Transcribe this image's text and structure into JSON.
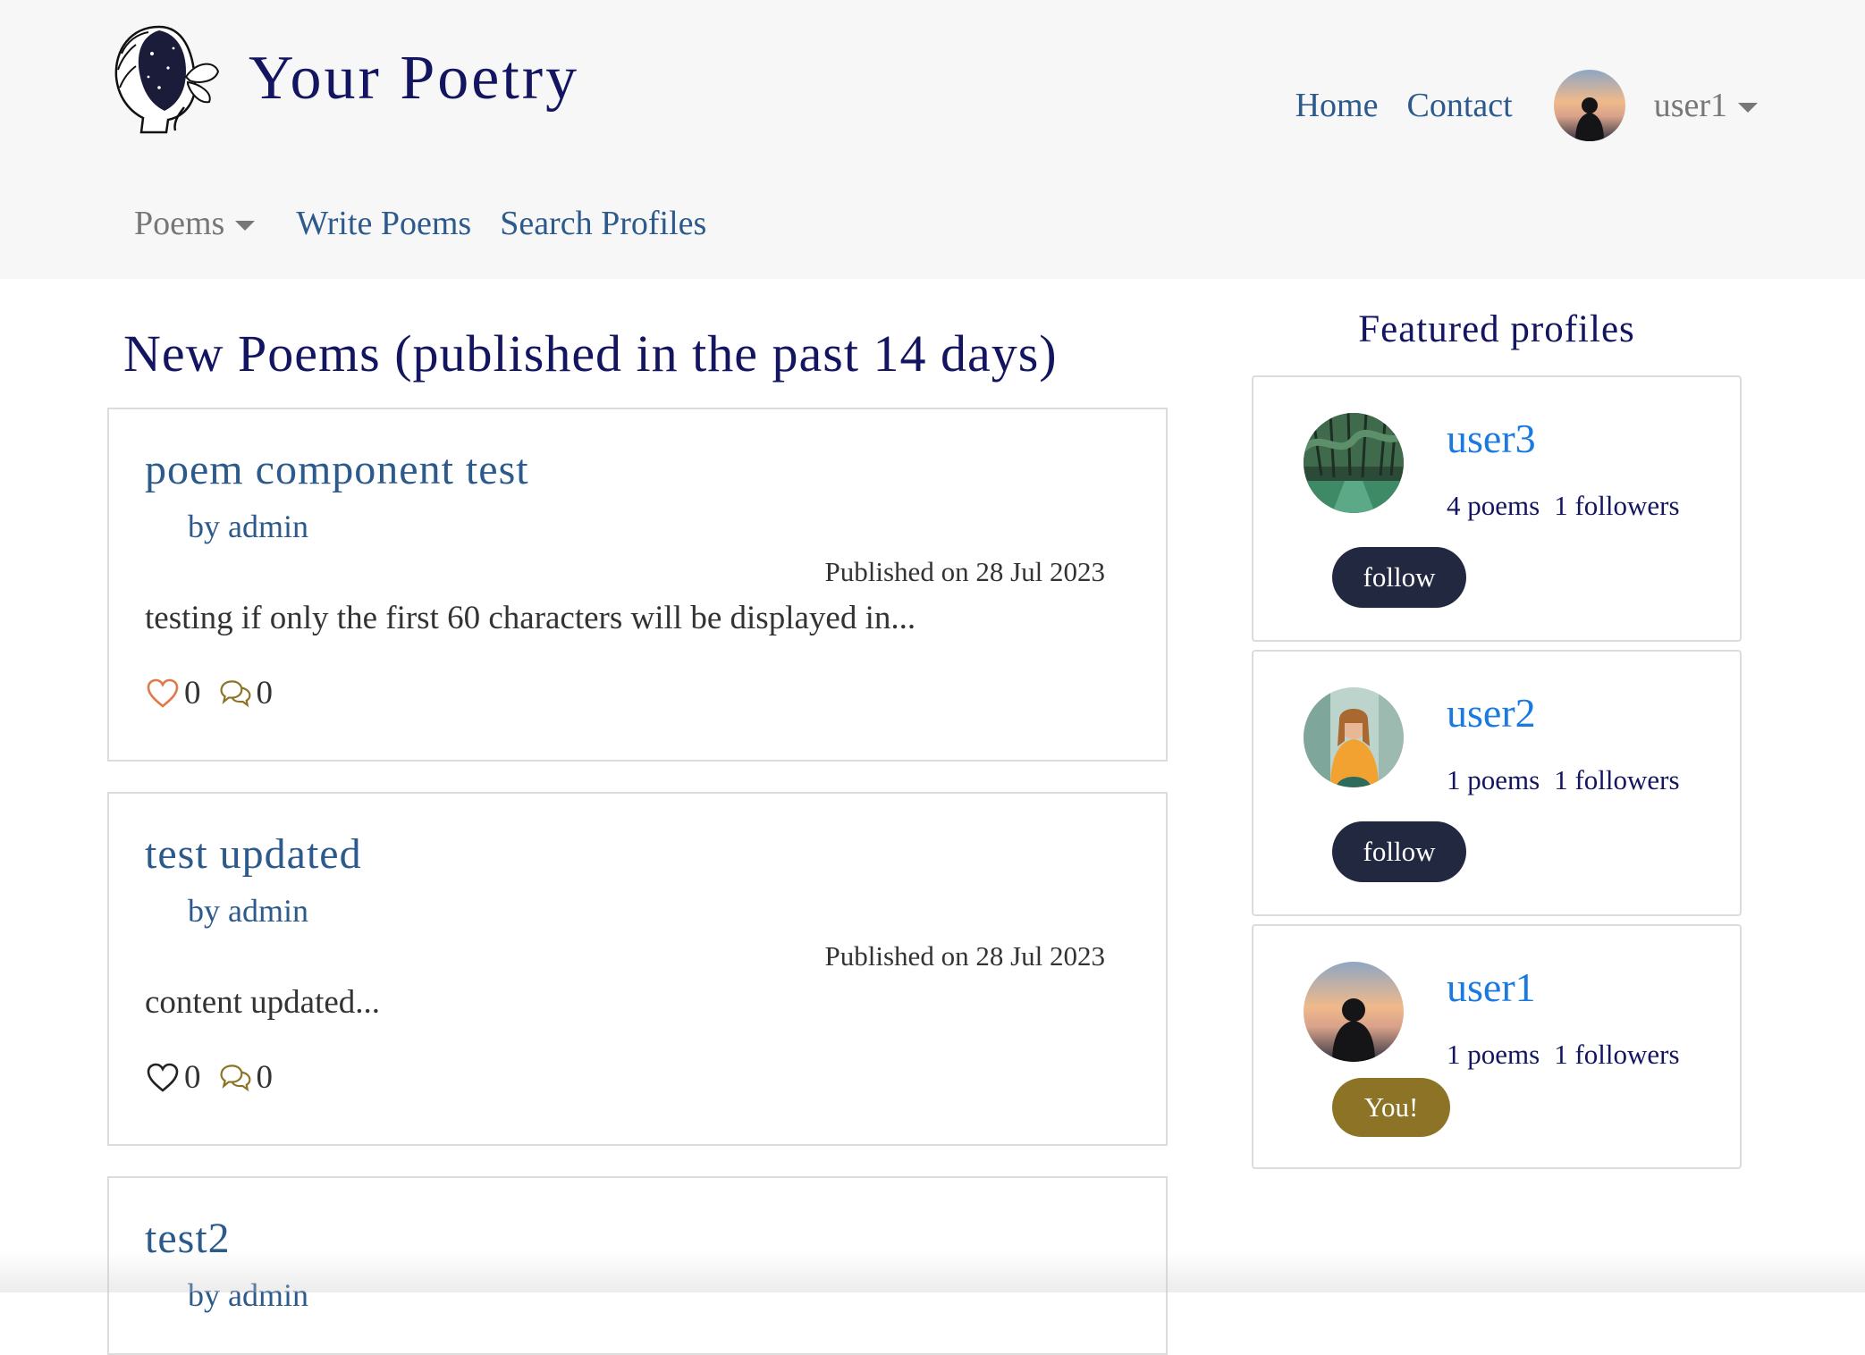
{
  "header": {
    "brand_title": "Your Poetry",
    "nav": {
      "home": "Home",
      "contact": "Contact",
      "username": "user1"
    },
    "subnav": {
      "poems": "Poems",
      "write": "Write Poems",
      "search": "Search Profiles"
    }
  },
  "main": {
    "section_title": "New Poems (published in the past 14 days)",
    "poems": [
      {
        "title": "poem component test",
        "author": "by admin",
        "date": "Published on 28 Jul 2023",
        "excerpt": "testing if only the first 60 characters will be displayed in...",
        "likes": "0",
        "comments": "0",
        "liked_color": "#e07a4a"
      },
      {
        "title": "test updated",
        "author": "by admin",
        "date": "Published on 28 Jul 2023",
        "excerpt": "content updated...",
        "likes": "0",
        "comments": "0",
        "liked_color": "#222222"
      },
      {
        "title": "test2",
        "author": "by admin"
      }
    ]
  },
  "sidebar": {
    "title": "Featured profiles",
    "profiles": [
      {
        "name": "user3",
        "poems": "4 poems",
        "followers": "1 followers",
        "action": "follow"
      },
      {
        "name": "user2",
        "poems": "1 poems",
        "followers": "1 followers",
        "action": "follow"
      },
      {
        "name": "user1",
        "poems": "1 poems",
        "followers": "1 followers",
        "badge": "You!"
      }
    ]
  },
  "colors": {
    "brand": "#141560",
    "link": "#2d5a8c",
    "profile_link": "#1a7ae0",
    "follow_button": "#222840",
    "you_badge": "#8c7326",
    "comment_icon": "#8c7326"
  },
  "icons": [
    "heart-icon",
    "comment-icon",
    "caret-down-icon"
  ]
}
